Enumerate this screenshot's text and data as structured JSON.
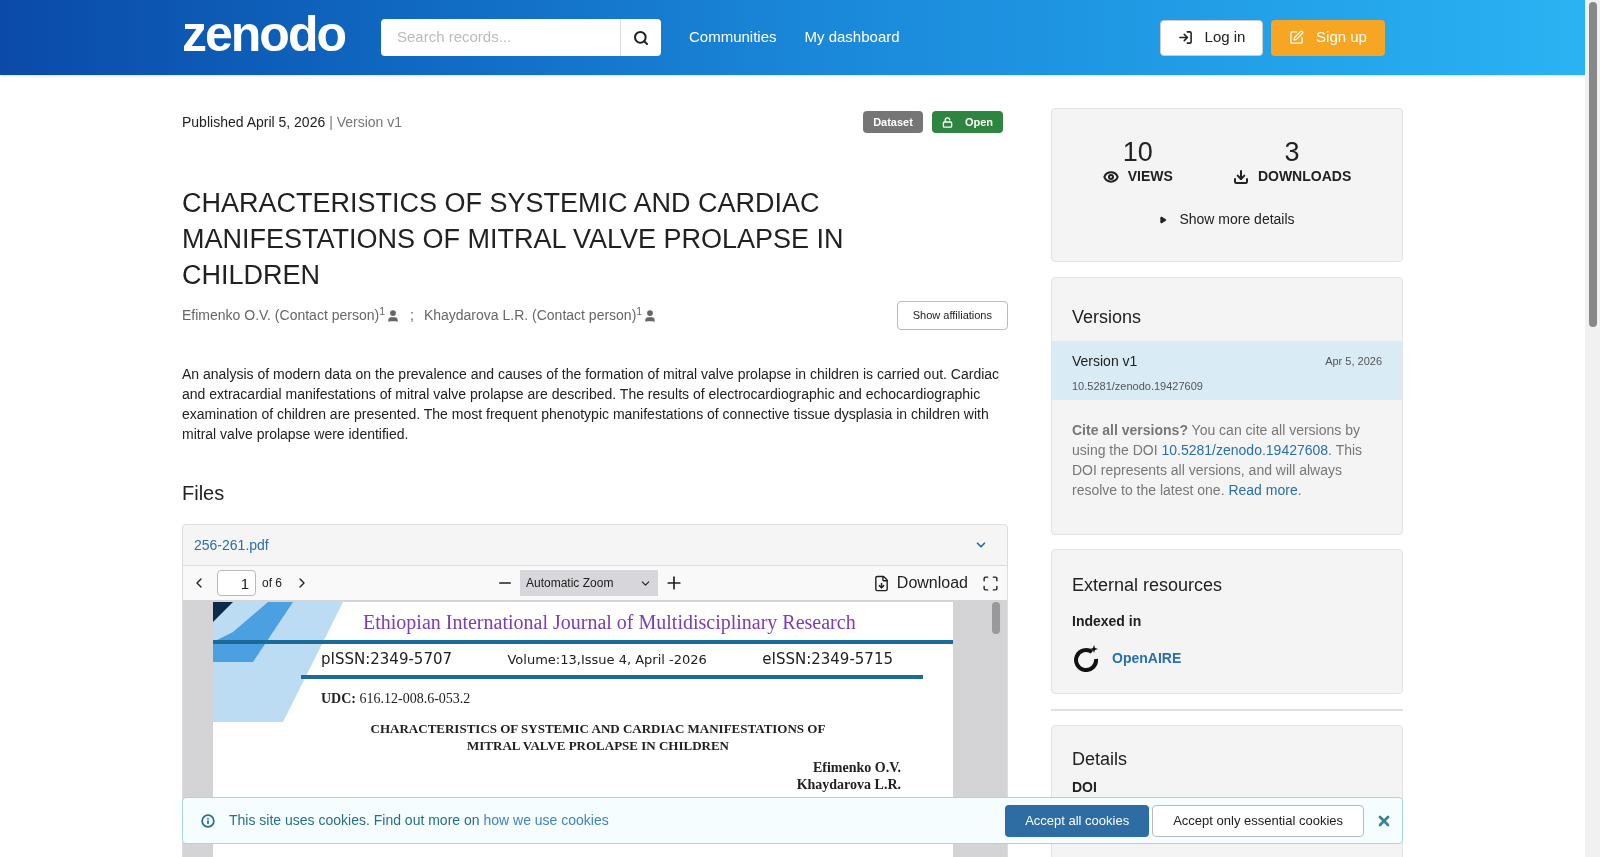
{
  "header": {
    "logo": "zenodo",
    "search": {
      "placeholder": "Search records..."
    },
    "nav": [
      "Communities",
      "My dashboard"
    ],
    "login": "Log in",
    "signup": "Sign up"
  },
  "record": {
    "published_label": "Published",
    "published_date": "April 5, 2026",
    "separator": "|",
    "version": "Version v1",
    "badges": [
      {
        "label": "Dataset",
        "kind": "type"
      },
      {
        "label": "Open",
        "kind": "access"
      }
    ],
    "title": "CHARACTERISTICS OF SYSTEMIC AND CARDIAC MANIFESTATIONS OF MITRAL VALVE PROLAPSE IN CHILDREN",
    "authors": [
      {
        "name": "Efimenko O.V. (Contact person)",
        "sup": "1"
      },
      {
        "name": "Khaydarova L.R. (Contact person)",
        "sup": "1"
      }
    ],
    "author_separator": ";",
    "affiliations_button": "Show affiliations",
    "abstract": "An analysis of modern data on the prevalence and causes of the formation of mitral valve prolapse in children is carried out. Cardiac and extracardial manifestations of mitral valve prolapse are described. The results of electrocardiographic and echocardiographic examination of children are presented. The most frequent phenotypic manifestations of connective tissue dysplasia in children with mitral valve prolapse were identified."
  },
  "files": {
    "heading": "Files",
    "file_name": "256-261.pdf",
    "expanded": true,
    "viewer": {
      "page": "1",
      "page_count": "of 6",
      "zoom": "Automatic Zoom",
      "download": "Download",
      "document": {
        "journal": "Ethiopian International Journal of Multidisciplinary Research",
        "pissn": "pISSN:2349-5707",
        "volume": "Volume:13,Issue 4, April -2026",
        "eissn": "eISSN:2349-5715",
        "udc_label": "UDC:",
        "udc": "616.12-008.6-053.2",
        "title_lines": [
          "CHARACTERISTICS OF SYSTEMIC AND CARDIAC MANIFESTATIONS OF",
          "MITRAL VALVE PROLAPSE IN CHILDREN"
        ],
        "authors": [
          "Efimenko O.V.",
          "Khaydarova L.R."
        ]
      }
    }
  },
  "stats": {
    "views": "10",
    "views_label": "VIEWS",
    "downloads": "3",
    "downloads_label": "DOWNLOADS",
    "more": "Show more details"
  },
  "versions": {
    "heading": "Versions",
    "items": [
      {
        "label": "Version v1",
        "date": "Apr 5, 2026",
        "doi": "10.5281/zenodo.19427609",
        "selected": true
      }
    ],
    "cite_bold": "Cite all versions?",
    "cite_text": "You can cite all versions by using the DOI",
    "cite_doi": "10.5281/zenodo.19427608",
    "cite_text2": ". This DOI represents all versions, and will always resolve to the latest one.",
    "read_more": "Read more",
    "end": "."
  },
  "external": {
    "heading": "External resources",
    "indexed_label": "Indexed in",
    "items": [
      "OpenAIRE"
    ]
  },
  "details": {
    "heading": "Details",
    "labels": [
      "DOI"
    ]
  },
  "cookies": {
    "text": "This site uses cookies. Find out more on",
    "link": "how we use cookies",
    "accept_all": "Accept all cookies",
    "accept_essential": "Accept only essential cookies"
  }
}
